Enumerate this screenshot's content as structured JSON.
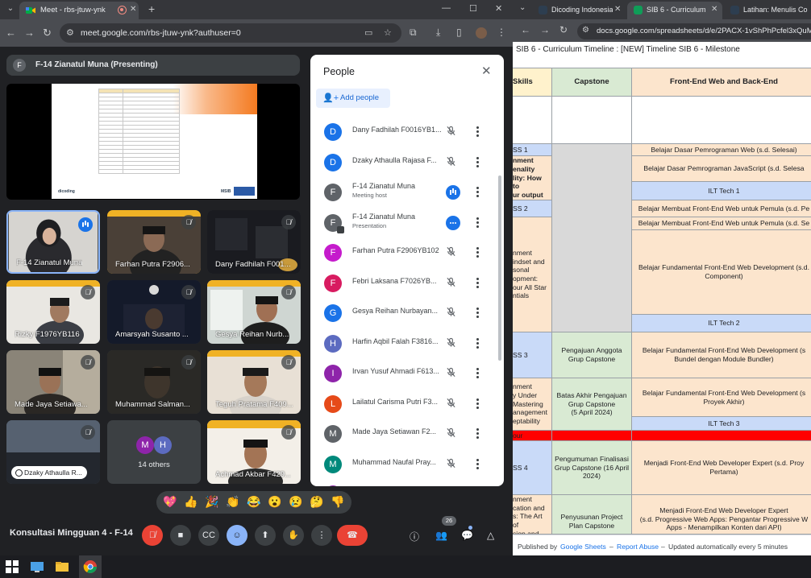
{
  "meet_window": {
    "tab_title": "Meet - rbs-jtuw-ynk",
    "url": "meet.google.com/rbs-jtuw-ynk?authuser=0",
    "presenter_label": "F-14 Zianatul Muna (Presenting)",
    "presenter_initial": "F",
    "tiles": [
      {
        "label": "F-14 Zianatul Muna",
        "speaking": true
      },
      {
        "label": "Farhan Putra F2906...",
        "muted": true
      },
      {
        "label": "Dany Fadhilah F001...",
        "muted": true
      },
      {
        "label": "Rizky F1976YB116",
        "muted": true
      },
      {
        "label": "Amarsyah Susanto ...",
        "muted": true
      },
      {
        "label": "Gesya Reihan Nurb...",
        "muted": true
      },
      {
        "label": "Made Jaya Setiawa...",
        "muted": true
      },
      {
        "label": "Muhammad Salman...",
        "muted": true
      },
      {
        "label": "Teguh Pratama F409...",
        "muted": true
      },
      {
        "label": "Dzaky Athaulla R...",
        "muted": true
      },
      {
        "label": "14 others",
        "avatars": [
          "M",
          "H"
        ]
      },
      {
        "label": "Achmad Akbar F429...",
        "muted": true
      }
    ],
    "people_panel": {
      "title": "People",
      "add_people": "Add people",
      "people": [
        {
          "initial": "D",
          "name": "Dany Fadhilah F0016YB1...",
          "color": "#1a73e8",
          "status": "muted"
        },
        {
          "initial": "D",
          "name": "Dzaky Athaulla Rajasa F...",
          "color": "#1a73e8",
          "status": "muted"
        },
        {
          "initial": "F",
          "name": "F-14 Zianatul Muna",
          "sub": "Meeting host",
          "color": "#5f6368",
          "status": "speaking"
        },
        {
          "initial": "F",
          "name": "F-14 Zianatul Muna",
          "sub": "Presentation",
          "color": "#5f6368",
          "status": "presenting"
        },
        {
          "initial": "F",
          "name": "Farhan Putra F2906YB102",
          "color": "#c51bcc",
          "status": "muted"
        },
        {
          "initial": "F",
          "name": "Febri Laksana F7026YB...",
          "color": "#d81b60",
          "status": "muted"
        },
        {
          "initial": "G",
          "name": "Gesya Reihan Nurbayan...",
          "color": "#1a73e8",
          "status": "muted"
        },
        {
          "initial": "H",
          "name": "Harfin Aqbil Falah F3816...",
          "color": "#5c6bc0",
          "status": "muted"
        },
        {
          "initial": "I",
          "name": "Irvan Yusuf Ahmadi F613...",
          "color": "#8e24aa",
          "status": "muted"
        },
        {
          "initial": "L",
          "name": "Lailatul Carisma Putri F3...",
          "color": "#e64a19",
          "status": "muted"
        },
        {
          "initial": "M",
          "name": "Made Jaya Setiawan F2...",
          "color": "#5f6368",
          "status": "muted"
        },
        {
          "initial": "M",
          "name": "Muhammad Naufal Pray...",
          "color": "#00897b",
          "status": "muted"
        },
        {
          "initial": "M",
          "name": "Muhammad Rizaldy Alifi...",
          "color": "#8e24aa",
          "status": "muted"
        }
      ]
    },
    "reactions": [
      "💖",
      "👍",
      "🎉",
      "👏",
      "😂",
      "😮",
      "😢",
      "🤔",
      "👎"
    ],
    "meeting_title": "Konsultasi Mingguan 4 - F-14",
    "participants_count": "26"
  },
  "sheets_window": {
    "tabs": [
      {
        "title": "Dicoding Indonesia"
      },
      {
        "title": "SIB 6 - Curriculum T..."
      },
      {
        "title": "Latihan: Menulis Co..."
      }
    ],
    "url": "docs.google.com/spreadsheets/d/e/2PACX-1vShPhPcfel3xQuMs-",
    "sheet_title": "SIB 6 - Curriculum Timeline : [NEW] Timeline SIB 6 - Milestone",
    "headers": {
      "col_a": "Skills",
      "col_b": "Capstone",
      "col_c": "Front-End Web and Back-End"
    },
    "col_a": [
      "SS 1",
      "nment\nenality\nlity: How to\nur output",
      "SS 2",
      "nment\nindset and\nsonal\nopment:\nour All Star\nntials",
      "SS 3",
      "nment\ny Under\nMastering\nanagement\neptability",
      "our",
      "SS 4",
      "nment\ncation and\ns: The Art of\nsion and"
    ],
    "col_b": [
      "Pengajuan Anggota Grup Capstone",
      "Batas Akhir Pengajuan Grup Capstone\n(5 April 2024)",
      "Pengumuman Finalisasi Grup Capstone (16 April 2024)",
      "Penyusunan Project Plan Capstone"
    ],
    "col_c": [
      "Belajar Dasar Pemrograman Web (s.d. Selesai)",
      "Belajar Dasar Pemrograman JavaScript (s.d. Selesa",
      "ILT Tech 1",
      "Belajar Membuat Front-End Web untuk Pemula (s.d. Pe",
      "Belajar Membuat Front-End Web untuk Pemula (s.d. Se",
      "Belajar Fundamental Front-End Web Development (s.d. Component)",
      "ILT Tech 2",
      "Belajar Fundamental Front-End Web Development (s Bundel dengan Module Bundler)",
      "Belajar Fundamental Front-End Web Development (s Proyek Akhir)",
      "ILT Tech 3",
      "Menjadi Front-End Web Developer Expert (s.d. Proy Pertama)",
      "Menjadi Front-End Web Developer Expert\n(s.d. Progressive Web Apps: Pengantar Progressive W\nApps - Menampilkan Konten dari API)"
    ],
    "footer": {
      "published_by": "Published by",
      "google_sheets": "Google Sheets",
      "dash1": "–",
      "report_abuse": "Report Abuse",
      "dash2": "–",
      "updated": "Updated automatically every 5 minutes"
    }
  },
  "colors": {
    "accent": "#1a73e8",
    "hangup": "#ea4335",
    "meet_bg": "#202124"
  }
}
